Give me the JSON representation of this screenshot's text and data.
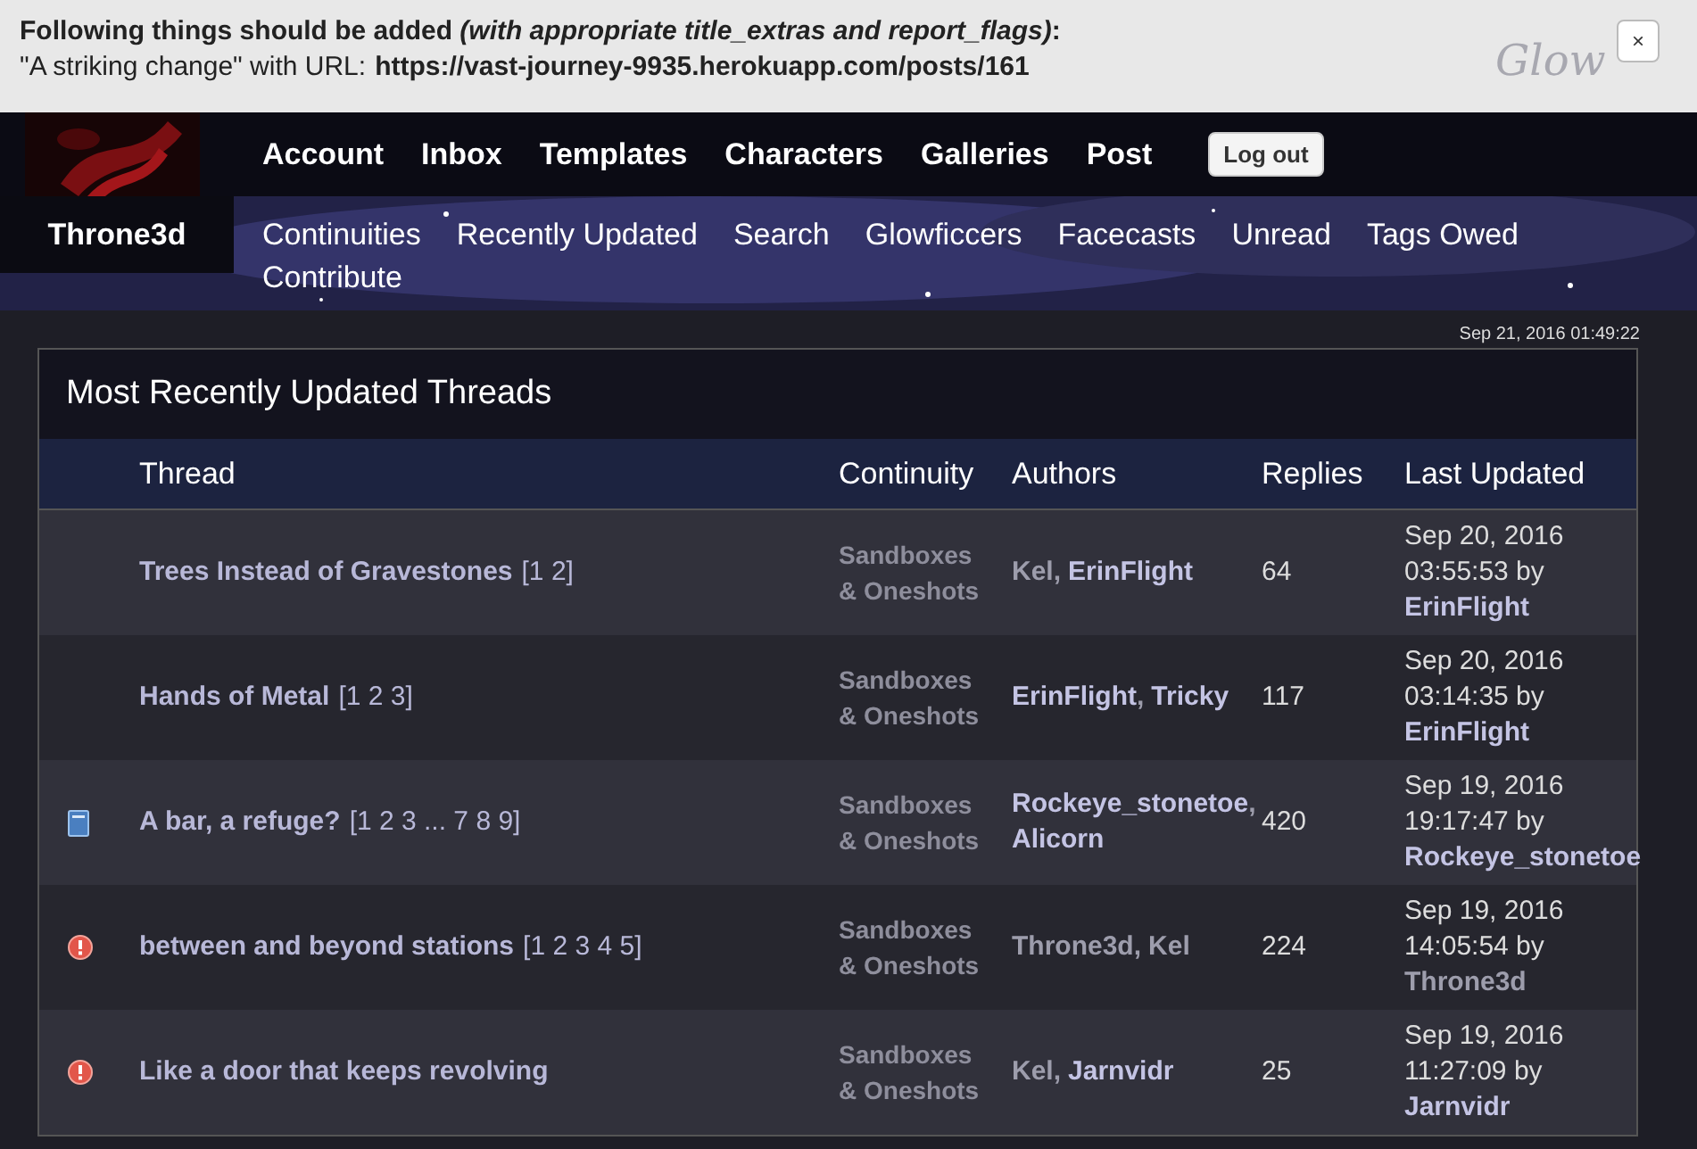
{
  "flash": {
    "heading": "Following things should be added",
    "heading_note": "(with appropriate title_extras and report_flags)",
    "heading_end": ":",
    "line_prefix": "\"A striking change\" with URL:",
    "url": "https://vast-journey-9935.herokuapp.com/posts/161",
    "close": "×"
  },
  "site_logo": "Glow",
  "header": {
    "nav": [
      "Account",
      "Inbox",
      "Templates",
      "Characters",
      "Galleries",
      "Post"
    ],
    "logout": "Log out",
    "username": "Throne3d",
    "subnav": [
      "Continuities",
      "Recently Updated",
      "Search",
      "Glowficcers",
      "Facecasts",
      "Unread",
      "Tags Owed",
      "Contribute"
    ]
  },
  "timestamp": "Sep 21, 2016 01:49:22",
  "table": {
    "title": "Most Recently Updated Threads",
    "columns": [
      "Thread",
      "Continuity",
      "Authors",
      "Replies",
      "Last Updated"
    ],
    "rows": [
      {
        "kind": "plain",
        "title": "Trees Instead of Gravestones",
        "pages": "[1 2]",
        "continuity": "Sandboxes & Oneshots",
        "authors": [
          {
            "name": "Kel",
            "separator": ",",
            "highlighted": false
          },
          {
            "name": "ErinFlight",
            "highlighted": true
          }
        ],
        "replies": "64",
        "updated_date": "Sep 20, 2016",
        "updated_time": "03:55:53 by",
        "updated_by": {
          "name": "ErinFlight",
          "highlighted": true
        }
      },
      {
        "kind": "plain",
        "title": "Hands of Metal",
        "pages": "[1 2 3]",
        "continuity": "Sandboxes & Oneshots",
        "authors": [
          {
            "name": "ErinFlight",
            "separator": ",",
            "highlighted": true
          },
          {
            "name": "Tricky",
            "highlighted": true
          }
        ],
        "replies": "117",
        "updated_date": "Sep 20, 2016",
        "updated_time": "03:14:35 by",
        "updated_by": {
          "name": "ErinFlight",
          "highlighted": true
        }
      },
      {
        "kind": "book",
        "title": "A bar, a refuge?",
        "pages": "[1 2 3 ... 7 8 9]",
        "continuity": "Sandboxes & Oneshots",
        "authors": [
          {
            "name": "Rockeye_stonetoe",
            "separator": ",",
            "highlighted": true
          },
          {
            "name": "Alicorn",
            "highlighted": true
          }
        ],
        "replies": "420",
        "updated_date": "Sep 19, 2016",
        "updated_time": "19:17:47 by",
        "updated_by": {
          "name": "Rockeye_stonetoe",
          "highlighted": true
        }
      },
      {
        "kind": "alert",
        "title": "between and beyond stations",
        "pages": "[1 2 3 4 5]",
        "continuity": "Sandboxes & Oneshots",
        "authors": [
          {
            "name": "Throne3d",
            "separator": ",",
            "highlighted": false
          },
          {
            "name": "Kel",
            "highlighted": false
          }
        ],
        "replies": "224",
        "updated_date": "Sep 19, 2016",
        "updated_time": "14:05:54 by",
        "updated_by": {
          "name": "Throne3d",
          "highlighted": false
        }
      },
      {
        "kind": "alert",
        "title": "Like a door that keeps revolving",
        "continuity": "Sandboxes & Oneshots",
        "authors": [
          {
            "name": "Kel",
            "separator": ",",
            "highlighted": false
          },
          {
            "name": "Jarnvidr",
            "highlighted": true
          }
        ],
        "replies": "25",
        "updated_date": "Sep 19, 2016",
        "updated_time": "11:27:09 by",
        "updated_by": {
          "name": "Jarnvidr",
          "highlighted": true
        }
      }
    ]
  }
}
